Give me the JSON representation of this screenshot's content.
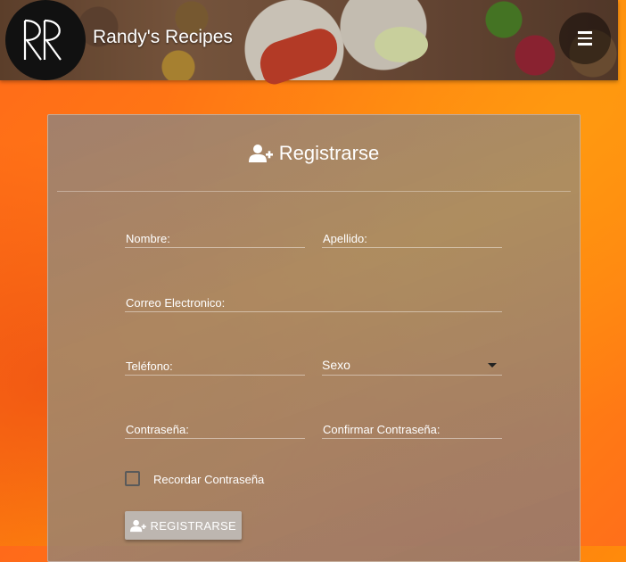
{
  "header": {
    "brand": "Randy's Recipes",
    "logo_icon": "rr-monogram-logo",
    "menu_icon": "hamburger-icon"
  },
  "form": {
    "title": "Registrarse",
    "title_icon": "user-plus-icon",
    "fields": {
      "first_name": "Nombre:",
      "last_name": "Apellido:",
      "email": "Correo Electronico:",
      "phone": "Teléfono:",
      "gender": "Sexo",
      "password": "Contraseña:",
      "confirm_password": "Confirmar Contraseña:"
    },
    "remember_label": "Recordar Contraseña",
    "remember_checked": false,
    "submit_label": "REGISTRARSE",
    "submit_icon": "user-plus-icon"
  },
  "colors": {
    "background": "#ff7a12",
    "card": "#9a8577",
    "button": "#bdb6b0",
    "text": "#ffffff"
  }
}
